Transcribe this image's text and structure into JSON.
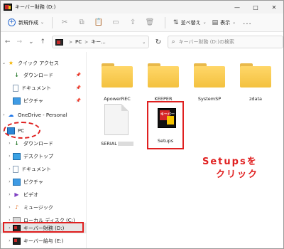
{
  "window": {
    "title": "キーバー財務 (D:)"
  },
  "window_buttons": [
    "—",
    "□",
    "✕"
  ],
  "command_bar": {
    "new_label": "新規作成",
    "sort_label": "並べ替え",
    "view_label": "表示",
    "more_label": "..."
  },
  "address_bar": {
    "crumbs": [
      "PC",
      "キー..."
    ],
    "search_placeholder": "キーバー財務 (D:)の検索"
  },
  "sidebar": {
    "items": [
      {
        "label": "クイック アクセス"
      },
      {
        "label": "ダウンロード"
      },
      {
        "label": "ドキュメント"
      },
      {
        "label": "ピクチャ"
      },
      {
        "label": "OneDrive - Personal"
      },
      {
        "label": "PC"
      },
      {
        "label": "ダウンロード"
      },
      {
        "label": "デスクトップ"
      },
      {
        "label": "ドキュメント"
      },
      {
        "label": "ピクチャ"
      },
      {
        "label": "ビデオ"
      },
      {
        "label": "ミュージック"
      },
      {
        "label": "ローカル ディスク (C:)"
      },
      {
        "label": "キーバー財務 (D:)"
      },
      {
        "label": "キーバー給与 (E:)"
      }
    ]
  },
  "main": {
    "folders": [
      {
        "name": "ApowerREC"
      },
      {
        "name": "KEEPER"
      },
      {
        "name": "SystemSP"
      },
      {
        "name": "zdata"
      }
    ],
    "files": [
      {
        "name": "SERIAL"
      },
      {
        "name": "Setups"
      }
    ],
    "setups_icon_text": "キーバー"
  },
  "annotation": {
    "line1": "Setupsを",
    "line2": "クリック"
  },
  "colors": {
    "annotation_red": "#e02020",
    "folder_yellow": "#f3c13f",
    "selection_gray": "#e6e6e6"
  }
}
